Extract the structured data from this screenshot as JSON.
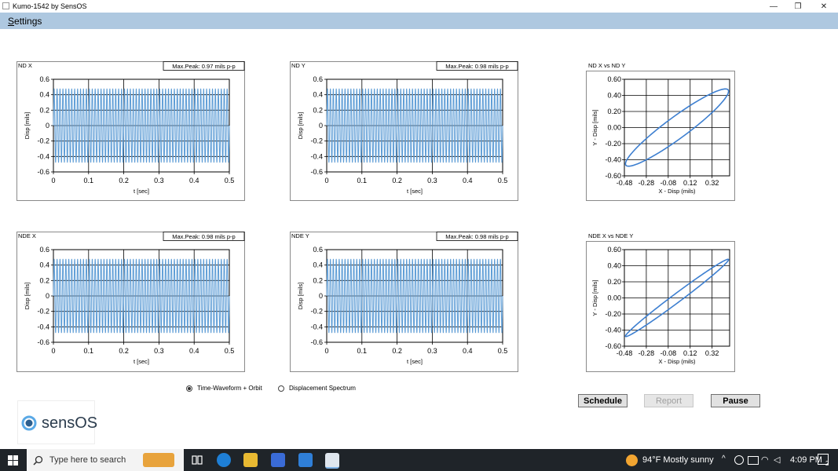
{
  "window": {
    "title": "Kumo-1542 by SensOS",
    "minimize": "—",
    "restore": "❐",
    "close": "✕"
  },
  "menu": {
    "settings_first": "S",
    "settings_rest": "ettings"
  },
  "waveform_axes": {
    "y_ticks": [
      "0.6",
      "0.4",
      "0.2",
      "0",
      "-0.2",
      "-0.4",
      "-0.6"
    ],
    "x_ticks": [
      "0",
      "0.1",
      "0.2",
      "0.3",
      "0.4",
      "0.5"
    ],
    "ylabel": "Disp [mils]",
    "xlabel": "t [sec]"
  },
  "orbit_axes": {
    "y_ticks": [
      "0.60",
      "0.40",
      "0.20",
      "0.00",
      "-0.20",
      "-0.40",
      "-0.60"
    ],
    "x_ticks": [
      "-0.48",
      "-0.28",
      "-0.08",
      "0.12",
      "0.32"
    ],
    "ylabel": "Y - Disp [mils]",
    "xlabel": "X - Disp (mils)"
  },
  "panels": {
    "nd_x": {
      "title": "ND X",
      "peak": "Max.Peak: 0.97 mils p-p"
    },
    "nd_y": {
      "title": "ND Y",
      "peak": "Max.Peak: 0.98 mils p-p"
    },
    "nde_x": {
      "title": "NDE X",
      "peak": "Max.Peak: 0.98 mils p-p"
    },
    "nde_y": {
      "title": "NDE Y",
      "peak": "Max.Peak: 0.98 mils p-p"
    },
    "orbit_nd": {
      "title": "ND X vs ND Y"
    },
    "orbit_nde": {
      "title": "NDE X vs NDE Y"
    }
  },
  "chart_data": [
    {
      "type": "line",
      "title": "ND X",
      "xlabel": "t [sec]",
      "ylabel": "Disp [mils]",
      "xlim": [
        0,
        0.5
      ],
      "ylim": [
        -0.6,
        0.6
      ],
      "grid": true,
      "series": [
        {
          "amplitude": 0.48,
          "cycles": 60
        }
      ]
    },
    {
      "type": "line",
      "title": "ND Y",
      "xlabel": "t [sec]",
      "ylabel": "Disp [mils]",
      "xlim": [
        0,
        0.5
      ],
      "ylim": [
        -0.6,
        0.6
      ],
      "grid": true,
      "series": [
        {
          "amplitude": 0.48,
          "cycles": 60
        }
      ]
    },
    {
      "type": "line",
      "title": "NDE X",
      "xlabel": "t [sec]",
      "ylabel": "Disp [mils]",
      "xlim": [
        0,
        0.5
      ],
      "ylim": [
        -0.6,
        0.6
      ],
      "grid": true,
      "series": [
        {
          "amplitude": 0.48,
          "cycles": 60
        }
      ]
    },
    {
      "type": "line",
      "title": "NDE Y",
      "xlabel": "t [sec]",
      "ylabel": "Disp [mils]",
      "xlim": [
        0,
        0.5
      ],
      "ylim": [
        -0.6,
        0.6
      ],
      "grid": true,
      "series": [
        {
          "amplitude": 0.48,
          "cycles": 60
        }
      ]
    },
    {
      "type": "scatter",
      "title": "ND X vs ND Y",
      "xlabel": "X - Disp (mils)",
      "ylabel": "Y - Disp (mils)",
      "xlim": [
        -0.48,
        0.48
      ],
      "ylim": [
        -0.6,
        0.6
      ],
      "grid": true,
      "series": [
        {
          "amp_x": 0.47,
          "amp_y": 0.48,
          "phase_deg": 20
        }
      ]
    },
    {
      "type": "scatter",
      "title": "NDE X vs NDE Y",
      "xlabel": "X - Disp (mils)",
      "ylabel": "Y - Disp (mils)",
      "xlim": [
        -0.48,
        0.48
      ],
      "ylim": [
        -0.6,
        0.6
      ],
      "grid": true,
      "series": [
        {
          "amp_x": 0.47,
          "amp_y": 0.48,
          "phase_deg": 8
        }
      ]
    }
  ],
  "mode": {
    "option1": "Time-Waveform + Orbit",
    "option2": "Displacement Spectrum",
    "selected": "Time-Waveform + Orbit"
  },
  "buttons": {
    "schedule": "Schedule",
    "report": "Report",
    "pause": "Pause"
  },
  "logo": {
    "text": "sensOS"
  },
  "taskbar": {
    "search_placeholder": "Type here to search",
    "weather": "94°F  Mostly sunny",
    "time": "4:09 PM",
    "notifications": "2"
  }
}
